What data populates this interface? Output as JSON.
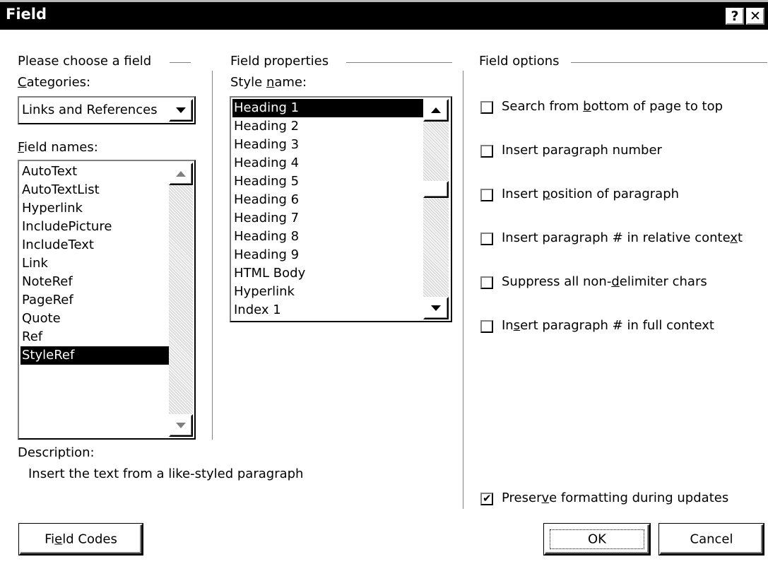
{
  "window": {
    "title": "Field",
    "help_glyph": "?",
    "close_glyph": "✕"
  },
  "left_panel": {
    "group_title": "Please choose a field",
    "categories_label": "Categories:",
    "categories_value": "Links and References",
    "field_names_label": "Field names:",
    "field_names": [
      "AutoText",
      "AutoTextList",
      "Hyperlink",
      "IncludePicture",
      "IncludeText",
      "Link",
      "NoteRef",
      "PageRef",
      "Quote",
      "Ref",
      "StyleRef"
    ],
    "selected_field": "StyleRef",
    "description_label": "Description:",
    "description_text": "Insert the text from a like-styled paragraph"
  },
  "middle_panel": {
    "group_title": "Field properties",
    "style_name_label": "Style name:",
    "styles": [
      "Heading 1",
      "Heading 2",
      "Heading 3",
      "Heading 4",
      "Heading 5",
      "Heading 6",
      "Heading 7",
      "Heading 8",
      "Heading 9",
      "HTML Body",
      "Hyperlink",
      "Index 1"
    ],
    "selected_style": "Heading 1"
  },
  "right_panel": {
    "group_title": "Field options",
    "options": [
      {
        "label": "Search from bottom of page to top",
        "checked": false
      },
      {
        "label": "Insert paragraph number",
        "checked": false
      },
      {
        "label": "Insert position of paragraph",
        "checked": false
      },
      {
        "label": "Insert paragraph # in relative context",
        "checked": false
      },
      {
        "label": "Suppress all non-delimiter chars",
        "checked": false
      },
      {
        "label": "Insert paragraph # in full context",
        "checked": false
      }
    ],
    "preserve_formatting": {
      "label": "Preserve formatting during updates",
      "checked": true
    }
  },
  "buttons": {
    "field_codes": "Field Codes",
    "ok": "OK",
    "cancel": "Cancel"
  },
  "colors": {
    "titlebar": "#000000",
    "selection": "#000000",
    "background": "#ffffff"
  }
}
